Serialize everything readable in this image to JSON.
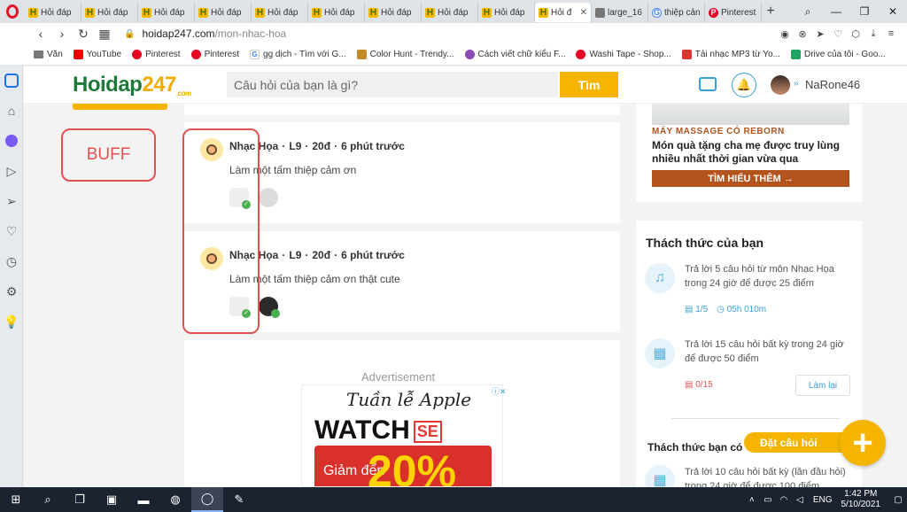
{
  "browser": {
    "tabs": [
      {
        "label": "Hỏi đáp",
        "favicon": "H",
        "active": false
      },
      {
        "label": "Hỏi đáp",
        "favicon": "H",
        "active": false
      },
      {
        "label": "Hỏi đáp",
        "favicon": "H",
        "active": false
      },
      {
        "label": "Hỏi đáp",
        "favicon": "H",
        "active": false
      },
      {
        "label": "Hỏi đáp",
        "favicon": "H",
        "active": false
      },
      {
        "label": "Hỏi đáp",
        "favicon": "H",
        "active": false
      },
      {
        "label": "Hỏi đáp",
        "favicon": "H",
        "active": false
      },
      {
        "label": "Hỏi đáp",
        "favicon": "H",
        "active": false
      },
      {
        "label": "Hỏi đáp",
        "favicon": "H",
        "active": false
      },
      {
        "label": "Hỏi đ",
        "favicon": "H",
        "active": true
      },
      {
        "label": "large_16",
        "favicon": "",
        "active": false
      },
      {
        "label": "thiệp cản",
        "favicon": "G",
        "active": false
      },
      {
        "label": "Pinterest",
        "favicon": "P",
        "active": false
      }
    ],
    "newtab": "+",
    "url_host": "hoidap247.com",
    "url_path": "/mon-nhac-hoa",
    "bookmarks": [
      {
        "label": "Văn",
        "icon": "folder-icon"
      },
      {
        "label": "YouTube",
        "icon": "youtube-icon"
      },
      {
        "label": "Pinterest",
        "icon": "pinterest-icon"
      },
      {
        "label": "Pinterest",
        "icon": "pinterest-icon"
      },
      {
        "label": "gg dịch - Tìm với G...",
        "icon": "google-icon"
      },
      {
        "label": "Color Hunt - Trendy...",
        "icon": "colorhunt-icon"
      },
      {
        "label": "Cách viết chữ kiểu F...",
        "icon": "at-icon"
      },
      {
        "label": "Washi Tape - Shop...",
        "icon": "pinterest-icon"
      },
      {
        "label": "Tải nhạc MP3 từ Yo...",
        "icon": "mp3-icon"
      },
      {
        "label": "Drive của tôi - Goo...",
        "icon": "drive-icon"
      }
    ]
  },
  "site": {
    "logo_main": "oidap",
    "logo_h": "H",
    "logo_247": "247",
    "logo_com": ".com",
    "search_placeholder": "Câu hỏi của bạn là gì?",
    "search_button": "Tìm",
    "username": "NaRone46"
  },
  "annotation": {
    "buff_label": "BUFF"
  },
  "feed": [
    {
      "author": "Nhạc Họa",
      "level": "L9",
      "points": "20đ",
      "time": "6 phút trước",
      "text": "Làm một tấm thiệp cảm ơn"
    },
    {
      "author": "Nhạc Họa",
      "level": "L9",
      "points": "20đ",
      "time": "6 phút trước",
      "text": "Làm một tấm thiệp cảm ơn thật cute"
    }
  ],
  "ad": {
    "label": "Advertisement",
    "line1": "Tuần lễ Apple",
    "line2": "WATCH",
    "se": "SE",
    "discount_prefix": "Giảm đến",
    "discount": "20%"
  },
  "right_ad": {
    "tag": "MÁY MASSAGE CÓ REBORN",
    "headline": "Món quà tặng cha mẹ được truy lùng nhiều nhất thời gian vừa qua",
    "cta": "TÌM HIỂU THÊM →"
  },
  "challenges": {
    "title": "Thách thức của bạn",
    "items": [
      {
        "text": "Trả lời 5 câu hỏi  từ môn Nhạc Họa trong 24 giờ để được 25 điểm",
        "progress": "1/5",
        "timer": "05h  010m"
      },
      {
        "text": "Trả lời 15 câu hỏi  bất kỳ  trong 24 giờ để được 50 điểm",
        "progress": "0/15",
        "retry": "Làm lại"
      }
    ],
    "sub_title": "Thách thức bạn có",
    "sub_item": "Trả lời 10 câu hỏi  bất kỳ (lần đầu hỏi) trong 24 giờ để được 100 điểm"
  },
  "fab": {
    "ask_label": "Đặt câu hỏi",
    "plus": "+"
  },
  "taskbar": {
    "lang": "ENG",
    "time": "1:42 PM",
    "date": "5/10/2021"
  }
}
